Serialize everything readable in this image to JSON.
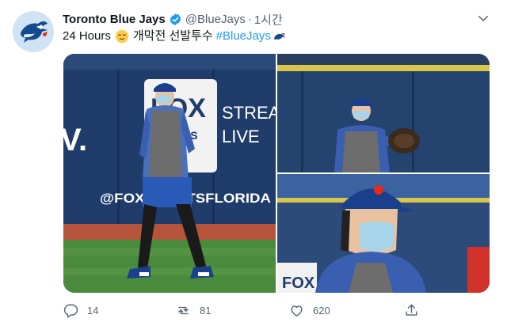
{
  "tweet": {
    "display_name": "Toronto Blue Jays",
    "handle": "@BlueJays",
    "separator": "·",
    "time": "1시간",
    "text_prefix": "24 Hours",
    "text_korean": "개막전 선발투수",
    "hashtag": "#BlueJays",
    "verified": true
  },
  "photos": [
    {
      "id": "photo-1",
      "signage": [
        "FOX",
        "SPORTS",
        "STREA",
        "LIVE",
        "@FOXSPORTSFLORIDA"
      ]
    },
    {
      "id": "photo-2"
    },
    {
      "id": "photo-3",
      "signage": [
        "FOX"
      ]
    }
  ],
  "actions": {
    "reply_count": "14",
    "retweet_count": "81",
    "like_count": "620"
  },
  "icons": {
    "verified": "verified-badge-icon",
    "caret": "chevron-down-icon",
    "emoji": "relieved-face-emoji",
    "hashflag": "blue-jays-bird-hashflag",
    "reply": "reply-icon",
    "retweet": "retweet-icon",
    "like": "heart-icon",
    "share": "share-icon"
  },
  "colors": {
    "link_blue": "#1d9bf0",
    "muted_gray": "#536471",
    "jays_blue": "#134a8e"
  }
}
